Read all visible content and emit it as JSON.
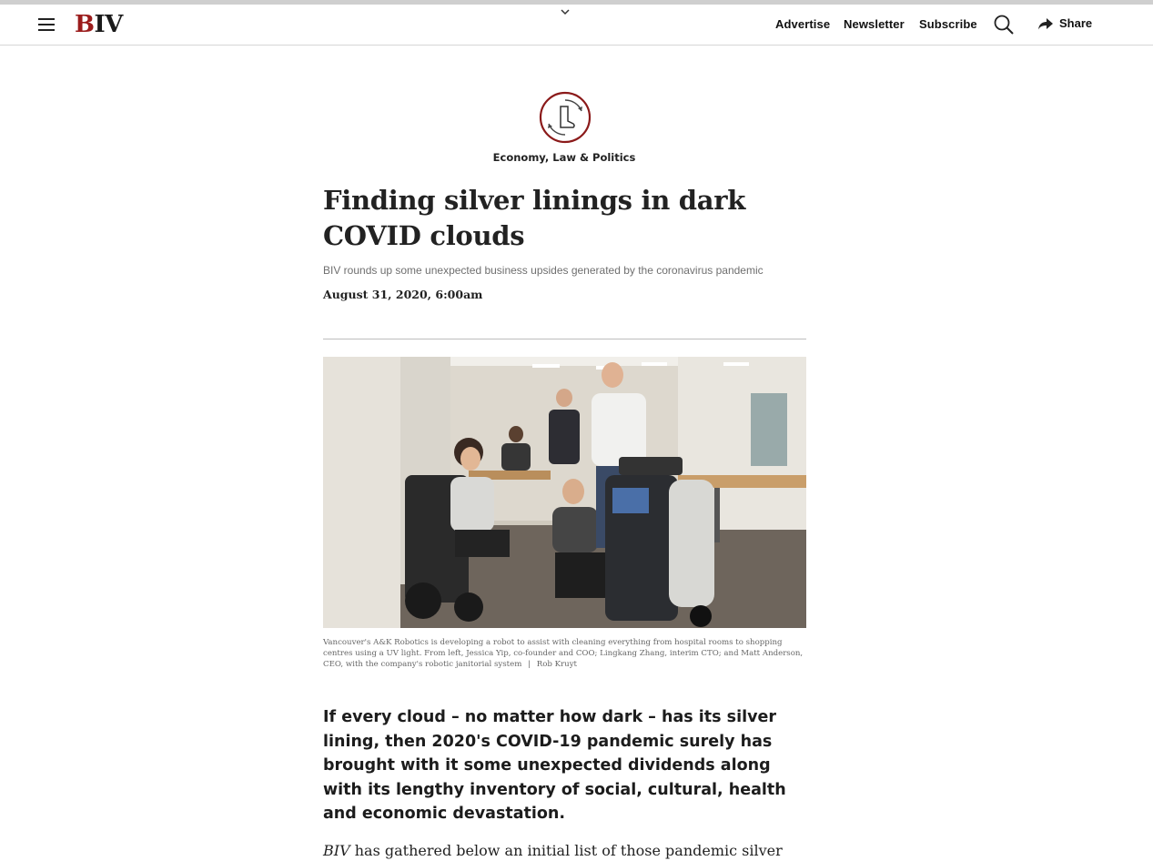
{
  "header": {
    "logo": {
      "first": "B",
      "rest": "IV"
    },
    "nav": {
      "advertise": "Advertise",
      "newsletter": "Newsletter",
      "subscribe": "Subscribe",
      "share": "Share"
    }
  },
  "article": {
    "category": "Economy, Law & Politics",
    "headline": "Finding silver linings in dark COVID clouds",
    "deck": "BIV rounds up some unexpected business upsides generated by the coronavirus pandemic",
    "date": "August 31, 2020, 6:00am",
    "caption": "Vancouver's A&K Robotics is developing a robot to assist with cleaning everything from hospital rooms to shopping centres using a UV light. From left, Jessica Yip, co-founder and COO; Lingkang Zhang, interim CTO; and Matt Anderson, CEO, with the company's robotic janitorial system",
    "caption_sep": "|",
    "caption_credit": "Rob Kruyt",
    "lead": "If every cloud – no matter how dark – has its silver lining, then 2020's COVID-19 pandemic surely has brought with it some unexpected dividends along with its lengthy inventory of social, cultural, health and economic devastation.",
    "body_em": "BIV",
    "body_rest": " has gathered below an initial list of those pandemic silver"
  },
  "colors": {
    "brand_red": "#9b1c1c",
    "text": "#222222",
    "muted": "#6f6f6f"
  }
}
